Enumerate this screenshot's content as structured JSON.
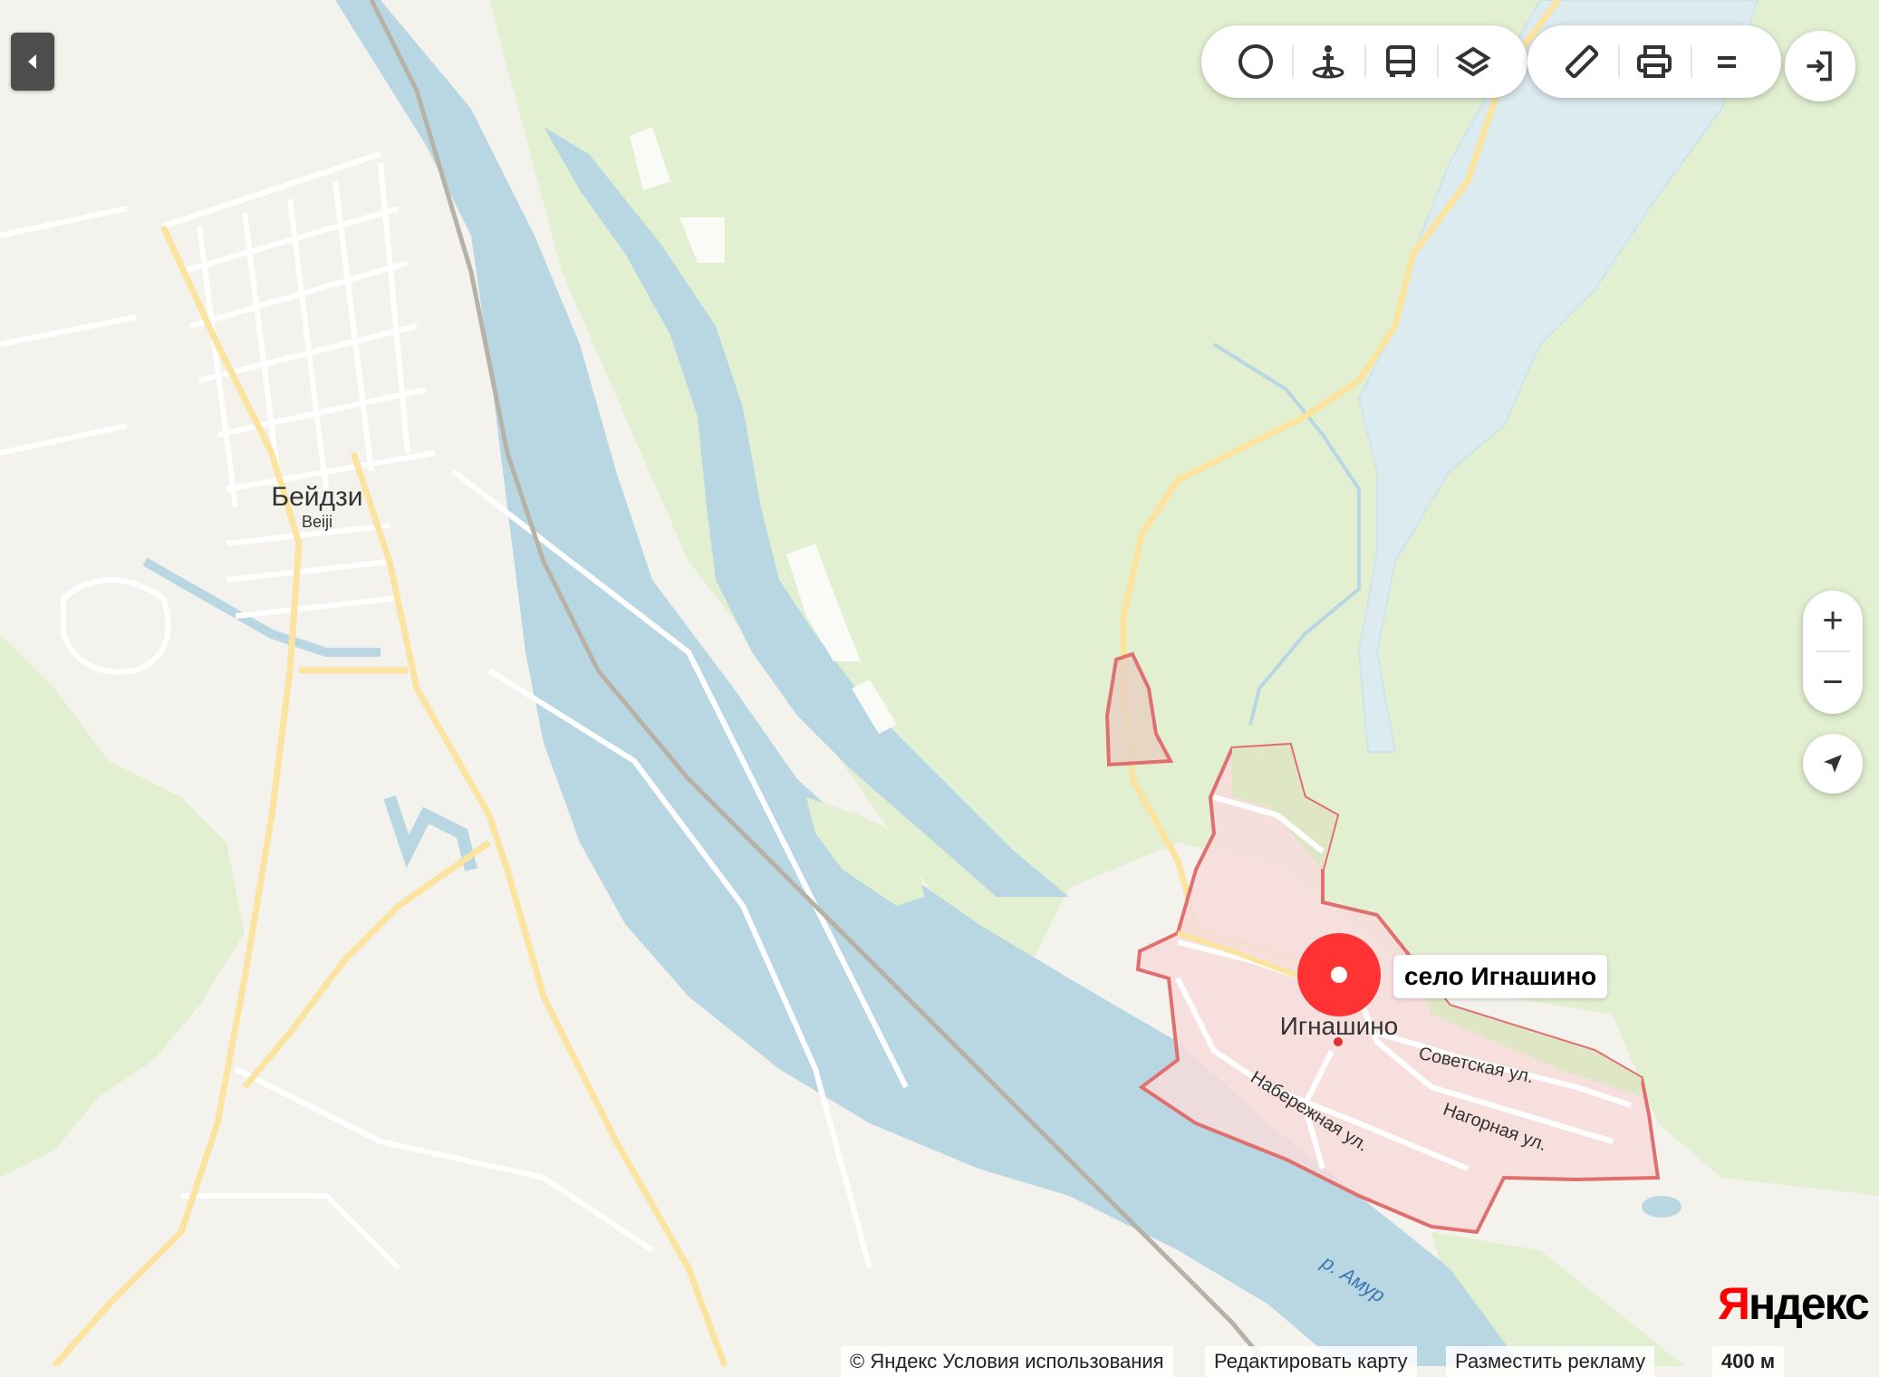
{
  "map": {
    "labels": {
      "beidzi": "Бейдзи",
      "beiji": "Beiji",
      "ignashino": "Игнашино",
      "sovetskaya": "Советская ул.",
      "naberezhnaya": "Набережная ул.",
      "nagornaya": "Нагорная ул.",
      "river": "р. Амур"
    },
    "pin_label": "село Игнашино",
    "colors": {
      "water": "#b9d7e3",
      "forest": "#e2f0d1",
      "land": "#f4f2ec",
      "road": "#fbe3a0",
      "boundary": "#e07070",
      "boundary_fill": "#f7dcdc",
      "pin": "#ff3333"
    }
  },
  "controls": {
    "toolbar": [
      {
        "name": "traffic-icon"
      },
      {
        "name": "panorama-icon"
      },
      {
        "name": "transport-icon"
      },
      {
        "name": "layers-icon"
      }
    ],
    "tools": [
      {
        "name": "ruler-icon"
      },
      {
        "name": "print-icon"
      },
      {
        "name": "menu-icon"
      }
    ],
    "zoom_in": "+",
    "zoom_out": "−"
  },
  "footer": {
    "copyright": "© Яндекс Условия использования",
    "edit_map": "Редактировать карту",
    "ads": "Разместить рекламу",
    "scale": "400 м",
    "logo_y": "Я",
    "logo_rest": "ндекс"
  }
}
